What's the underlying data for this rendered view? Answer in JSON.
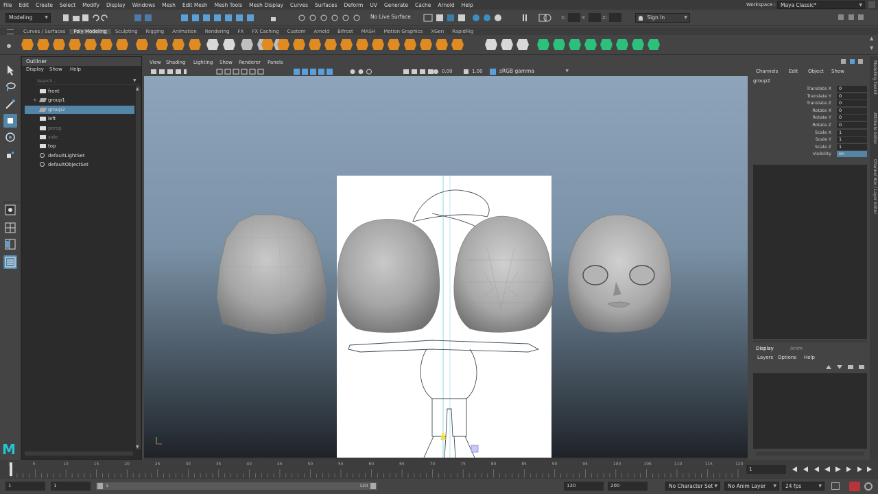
{
  "menubar": {
    "items": [
      "File",
      "Edit",
      "Create",
      "Select",
      "Modify",
      "Display",
      "Windows",
      "Mesh",
      "Edit Mesh",
      "Mesh Tools",
      "Mesh Display",
      "Curves",
      "Surfaces",
      "Deform",
      "UV",
      "Generate",
      "Cache",
      "Arnold",
      "Help"
    ],
    "workspace_label": "Workspace :",
    "workspace_value": "Maya Classic*"
  },
  "statusline": {
    "mode_menu": "Modeling",
    "live_surface": "No Live Surface",
    "x_label": "X:",
    "y_label": "Y:",
    "z_label": "Z:",
    "sign_in": "Sign In"
  },
  "shelf": {
    "tabs": [
      "Curves / Surfaces",
      "Poly Modeling",
      "Sculpting",
      "Rigging",
      "Animation",
      "Rendering",
      "FX",
      "FX Caching",
      "Custom",
      "Arnold",
      "Bifrost",
      "MASH",
      "Motion Graphics",
      "XGen",
      "RapidRig"
    ],
    "active_tab": 1
  },
  "outliner": {
    "title": "Outliner",
    "menu": [
      "Display",
      "Show",
      "Help"
    ],
    "search_placeholder": "Search...",
    "rows": [
      {
        "label": "front",
        "icon": "camera-icon",
        "selected": false,
        "dim": false,
        "expand": false
      },
      {
        "label": "group1",
        "icon": "group-icon",
        "selected": false,
        "dim": false,
        "expand": true
      },
      {
        "label": "group2",
        "icon": "group-icon",
        "selected": true,
        "dim": false,
        "expand": false
      },
      {
        "label": "left",
        "icon": "camera-icon",
        "selected": false,
        "dim": false,
        "expand": false
      },
      {
        "label": "persp",
        "icon": "camera-icon",
        "selected": false,
        "dim": true,
        "expand": false
      },
      {
        "label": "side",
        "icon": "camera-icon",
        "selected": false,
        "dim": true,
        "expand": false
      },
      {
        "label": "top",
        "icon": "camera-icon",
        "selected": false,
        "dim": false,
        "expand": false
      },
      {
        "label": "defaultLightSet",
        "icon": "set-icon",
        "selected": false,
        "dim": false,
        "expand": false
      },
      {
        "label": "defaultObjectSet",
        "icon": "set-icon",
        "selected": false,
        "dim": false,
        "expand": false
      }
    ]
  },
  "viewport": {
    "menu": [
      "View",
      "Shading",
      "Lighting",
      "Show",
      "Renderer",
      "Panels"
    ],
    "exposure": "0.00",
    "gamma": "1.00",
    "color_space": "sRGB gamma"
  },
  "channel_box": {
    "menu": [
      "Channels",
      "Edit",
      "Object",
      "Show"
    ],
    "object_name": "group2",
    "channels": [
      {
        "label": "Translate X",
        "value": "0"
      },
      {
        "label": "Translate Y",
        "value": "0"
      },
      {
        "label": "Translate Z",
        "value": "0"
      },
      {
        "label": "Rotate X",
        "value": "0"
      },
      {
        "label": "Rotate Y",
        "value": "0"
      },
      {
        "label": "Rotate Z",
        "value": "0"
      },
      {
        "label": "Scale X",
        "value": "1"
      },
      {
        "label": "Scale Y",
        "value": "1"
      },
      {
        "label": "Scale Z",
        "value": "1"
      },
      {
        "label": "Visibility",
        "value": "on"
      }
    ]
  },
  "layer_editor": {
    "tabs": [
      "Display",
      "Anim"
    ],
    "menu": [
      "Layers",
      "Options",
      "Help"
    ]
  },
  "side_tabs": [
    "Modelling Toolkit",
    "Attribute Editor",
    "Channel Box / Layer Editor"
  ],
  "timeline": {
    "ticks": [
      "1",
      "5",
      "10",
      "15",
      "20",
      "25",
      "30",
      "35",
      "40",
      "45",
      "50",
      "55",
      "60",
      "65",
      "70",
      "75",
      "80",
      "85",
      "90",
      "95",
      "100",
      "105",
      "110",
      "115",
      "120"
    ],
    "current_frame": "1"
  },
  "range": {
    "start": "1",
    "playback_start": "1",
    "slider_start": "1",
    "slider_end": "120",
    "playback_end": "120",
    "end": "200",
    "character_set": "No Character Set",
    "anim_layer": "No Anim Layer",
    "fps": "24 fps"
  }
}
